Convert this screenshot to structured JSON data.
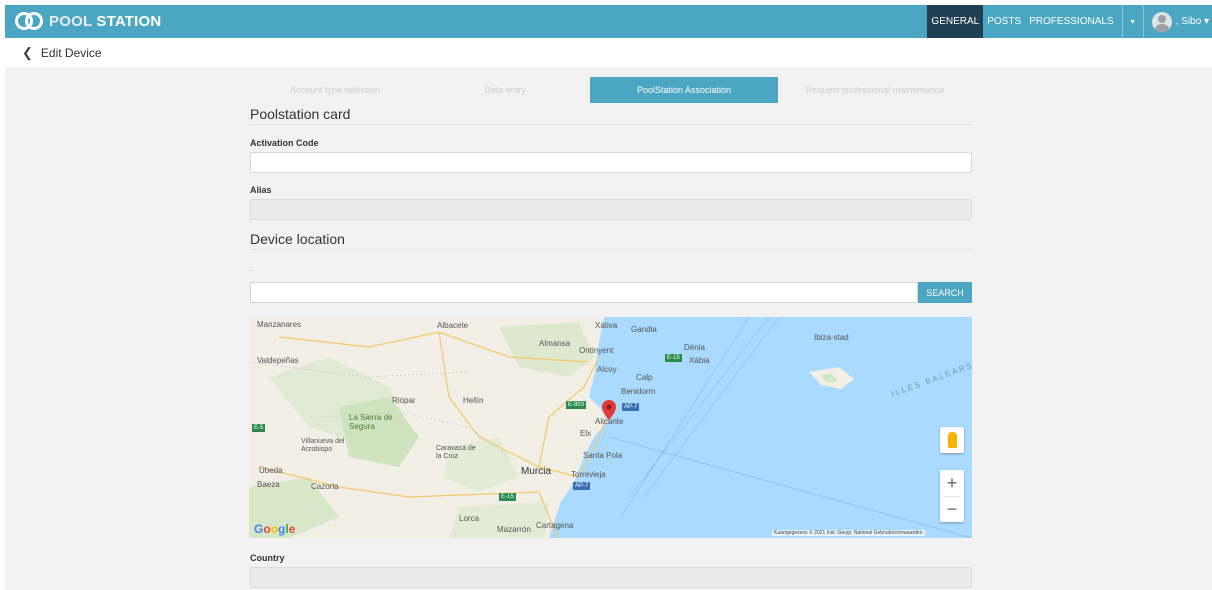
{
  "header": {
    "logo_text_a": "POOL",
    "logo_text_b": "STATION",
    "nav": [
      "GENERAL",
      "POSTS",
      "PROFESSIONALS"
    ],
    "user": ", Sibo"
  },
  "breadcrumb": "Edit Device",
  "steps": [
    "Account type selection",
    "Data entry",
    "PoolStation Association",
    "Request professional maintenance"
  ],
  "poolstation_card": {
    "title": "Poolstation card",
    "activation_label": "Activation Code",
    "activation_value": "",
    "alias_label": "Alias",
    "alias_value": ""
  },
  "device_location": {
    "title": "Device location",
    "hint": ":",
    "search_value": "",
    "search_button": "SEARCH"
  },
  "map": {
    "labels": [
      "Manzanares",
      "Albacete",
      "Xàtiva",
      "Gandia",
      "Almansa",
      "Ontinyent",
      "Dénia",
      "Valdepeñas",
      "Xàbia",
      "Alcoy",
      "Calp",
      "Benidorm",
      "Ibiza-stad",
      "ILLES BALEARS",
      "Riópar",
      "Hellín",
      "La Sierra de Segura",
      "Alicante",
      "Elx",
      "Villanueva del Arzobispo",
      "Caravaca de la Cruz",
      "Santa Pola",
      "Úbeda",
      "Murcia",
      "Torrevieja",
      "Baeza",
      "Cazorla",
      "Lorca",
      "Mazarrón",
      "Cartagena"
    ],
    "roads": [
      "E-15",
      "E-903",
      "AP-7",
      "E-5"
    ],
    "attribution": "Kaartgegevens © 2021 Inst. Geogr. National   Gebruiksvoorwaarden",
    "google": "Google",
    "zoom_in": "+",
    "zoom_out": "−"
  },
  "country": {
    "label": "Country",
    "value": ""
  },
  "colors": {
    "accent": "#4aa6c2",
    "nav_active": "#1f3f52",
    "content_bg": "#f2f2f2"
  }
}
